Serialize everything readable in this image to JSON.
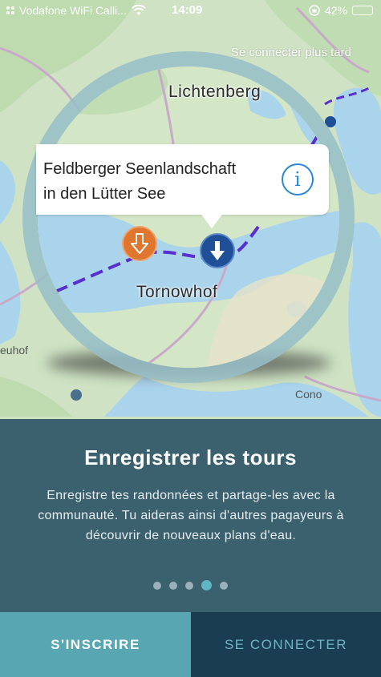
{
  "status_bar": {
    "carrier": "Vodafone WiFi Calli...",
    "time": "14:09",
    "battery_text": "42%",
    "battery_level": 0.42,
    "signal_icon": "signal-dots-icon",
    "wifi_icon": "wifi-icon",
    "lock_icon": "orientation-lock-icon"
  },
  "skip_label": "Se connecter plus tard",
  "map": {
    "labels": {
      "lichtenberg": "Lichtenberg",
      "tornowhof": "Tornowhof"
    },
    "background_labels": {
      "left": "euhof",
      "right": "Cono"
    },
    "callout": {
      "line1": "Feldberger Seenlandschaft",
      "line2": "in den Lütter See",
      "info_glyph": "i"
    },
    "pins": {
      "start_icon": "arrow-down-outline-icon",
      "end_icon": "arrow-down-icon"
    },
    "colors": {
      "water": "#aad3ec",
      "land": "#d3e6c6",
      "route": "#5a2fd0",
      "pin_orange": "#e0762e",
      "pin_blue": "#1f4f96"
    }
  },
  "onboarding": {
    "title": "Enregistrer les tours",
    "description": "Enregistre tes randonnées et partage-les avec la communauté. Tu aideras ainsi d'autres pagayeurs à découvrir de nouveaux plans d'eau.",
    "page_count": 5,
    "active_page": 4
  },
  "buttons": {
    "signup": "S'INSCRIRE",
    "login": "SE CONNECTER"
  },
  "colors": {
    "panel": "#234b5f",
    "signup_bg": "#58a6b1",
    "login_bg": "#1b3d52",
    "accent": "#5fb6c4"
  }
}
